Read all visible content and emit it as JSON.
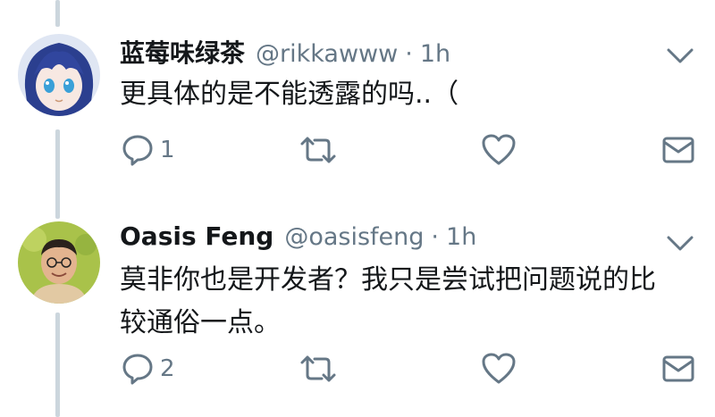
{
  "tweets": [
    {
      "display_name": "蓝莓味绿茶",
      "handle": "@rikkawww",
      "separator": "·",
      "time": "1h",
      "text": "更具体的是不能透露的吗..（",
      "reply_count": "1",
      "avatar_icon": "anime-avatar-icon"
    },
    {
      "display_name": "Oasis Feng",
      "handle": "@oasisfeng",
      "separator": "·",
      "time": "1h",
      "text": "莫非你也是开发者？我只是尝试把问题说的比\n较通俗一点。",
      "reply_count": "2",
      "avatar_icon": "person-avatar-icon"
    }
  ],
  "colors": {
    "text": "#14171a",
    "muted": "#657786",
    "thread_line": "#ccd6dd"
  }
}
